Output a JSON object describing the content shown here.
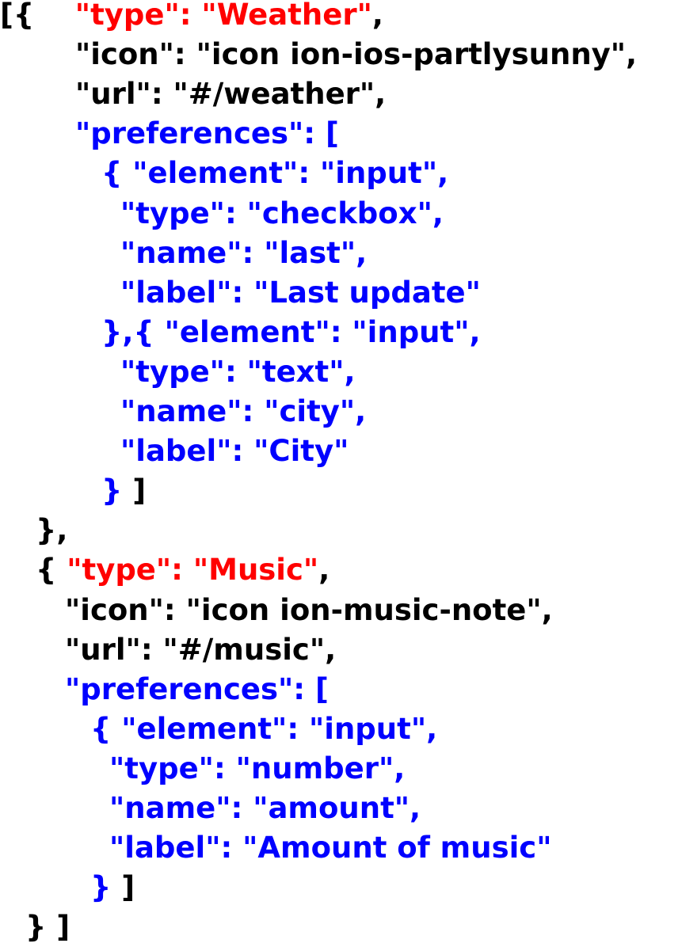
{
  "colors": {
    "black": "#000000",
    "red": "#ff0000",
    "blue": "#0000ff"
  },
  "lines": [
    {
      "indent": 0,
      "segs": [
        {
          "t": "[{",
          "c": "black"
        },
        {
          "t": "    ",
          "c": "black"
        },
        {
          "t": "\"type\": \"Weather\"",
          "c": "red"
        },
        {
          "t": ",",
          "c": "black"
        }
      ]
    },
    {
      "indent": 95,
      "segs": [
        {
          "t": "\"icon\": \"icon ion-ios-partlysunny\",",
          "c": "black"
        }
      ]
    },
    {
      "indent": 95,
      "segs": [
        {
          "t": "\"url\": \"#/weather\",",
          "c": "black"
        }
      ]
    },
    {
      "indent": 95,
      "segs": [
        {
          "t": "\"preferences\": [",
          "c": "blue"
        }
      ]
    },
    {
      "indent": 128,
      "segs": [
        {
          "t": "{ \"element\": \"input\",",
          "c": "blue"
        }
      ]
    },
    {
      "indent": 152,
      "segs": [
        {
          "t": "\"type\": \"checkbox\",",
          "c": "blue"
        }
      ]
    },
    {
      "indent": 152,
      "segs": [
        {
          "t": "\"name\": \"last\",",
          "c": "blue"
        }
      ]
    },
    {
      "indent": 152,
      "segs": [
        {
          "t": "\"label\": \"Last update\"",
          "c": "blue"
        }
      ]
    },
    {
      "indent": 128,
      "segs": [
        {
          "t": "},{ \"element\": \"input\",",
          "c": "blue"
        }
      ]
    },
    {
      "indent": 152,
      "segs": [
        {
          "t": "\"type\": \"text\",",
          "c": "blue"
        }
      ]
    },
    {
      "indent": 152,
      "segs": [
        {
          "t": "\"name\": \"city\",",
          "c": "blue"
        }
      ]
    },
    {
      "indent": 152,
      "segs": [
        {
          "t": "\"label\": \"City\"",
          "c": "blue"
        }
      ]
    },
    {
      "indent": 128,
      "segs": [
        {
          "t": "}",
          "c": "blue"
        },
        {
          "t": " ]",
          "c": "black"
        }
      ]
    },
    {
      "indent": 45,
      "segs": [
        {
          "t": "},",
          "c": "black"
        }
      ]
    },
    {
      "indent": 45,
      "segs": [
        {
          "t": "{ ",
          "c": "black"
        },
        {
          "t": "\"type\": \"Music\"",
          "c": "red"
        },
        {
          "t": ",",
          "c": "black"
        }
      ]
    },
    {
      "indent": 82,
      "segs": [
        {
          "t": "\"icon\": \"icon ion-music-note\",",
          "c": "black"
        }
      ]
    },
    {
      "indent": 82,
      "segs": [
        {
          "t": "\"url\": \"#/music\",",
          "c": "black"
        }
      ]
    },
    {
      "indent": 82,
      "segs": [
        {
          "t": "\"preferences\": [",
          "c": "blue"
        }
      ]
    },
    {
      "indent": 114,
      "segs": [
        {
          "t": "{ \"element\": \"input\",",
          "c": "blue"
        }
      ]
    },
    {
      "indent": 138,
      "segs": [
        {
          "t": "\"type\": \"number\",",
          "c": "blue"
        }
      ]
    },
    {
      "indent": 138,
      "segs": [
        {
          "t": "\"name\": \"amount\",",
          "c": "blue"
        }
      ]
    },
    {
      "indent": 138,
      "segs": [
        {
          "t": "\"label\": \"Amount of music\"",
          "c": "blue"
        }
      ]
    },
    {
      "indent": 114,
      "segs": [
        {
          "t": "}",
          "c": "blue"
        },
        {
          "t": " ]",
          "c": "black"
        }
      ]
    },
    {
      "indent": 32,
      "segs": [
        {
          "t": "} ]",
          "c": "black"
        }
      ]
    }
  ]
}
